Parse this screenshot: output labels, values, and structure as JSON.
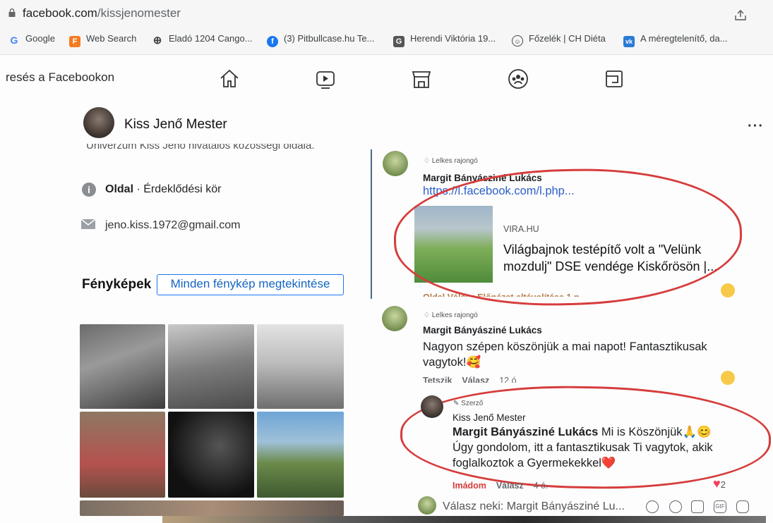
{
  "browser": {
    "url_domain": "facebook.com",
    "url_path": "/kissjenomester"
  },
  "bookmarks": [
    {
      "label": "Google",
      "icon": "G",
      "color": "#4285f4"
    },
    {
      "label": "Web Search",
      "icon": "F",
      "color": "#f47b20"
    },
    {
      "label": "Eladó 1204 Cango...",
      "icon": "globe-icon",
      "color": "#444444"
    },
    {
      "label": "(3) Pitbullcase.hu Te...",
      "icon": "f",
      "color": "#1877f2"
    },
    {
      "label": "Herendi Viktória 19...",
      "icon": "G",
      "color": "#555555"
    },
    {
      "label": "Főzelék | CH Diéta",
      "icon": "chef-icon",
      "color": "#444444"
    },
    {
      "label": "A méregtelenítő, da...",
      "icon": "vk",
      "color": "#2a7bd6"
    }
  ],
  "nav": {
    "search_text": "resés a Facebookon"
  },
  "page": {
    "name": "Kiss Jenő Mester",
    "about_cut": "Univerzum Kiss Jenő hivatalos közösségi oldala.",
    "category_bold": "Oldal",
    "category_rest": " · Érdeklődési kör",
    "email": "jeno.kiss.1972@gmail.com",
    "photos_title": "Fényképek",
    "photos_button": "Minden fénykép megtekintése"
  },
  "comments": [
    {
      "badge": "Lelkes rajongó",
      "author": "Margit Bányásziné Lukács",
      "link": "https://l.facebook.com/l.php...",
      "preview_site": "VIRA.HU",
      "preview_title": "Világbajnok testépítő volt a \"Velünk mozdulj\" DSE vendége Kiskőrösön |...",
      "actions_cut": "Oldal   Válasz   Előnézet eltávolítása   1 n"
    },
    {
      "badge": "Lelkes rajongó",
      "author": "Margit Bányásziné Lukács",
      "text": "Nagyon szépen köszönjük a mai napot! Fantasztikusak vagytok!🥰",
      "like": "Tetszik",
      "reply": "Válasz",
      "time": "12 ó"
    },
    {
      "badge": "Szerző",
      "author": "Kiss Jenő Mester",
      "mention": "Margit Bányásziné Lukács",
      "text": " Mi is Köszönjük🙏😊 Úgy gondolom, itt a fantasztikusak Ti vagytok, akik foglalkoztok a Gyermekekkel❤️",
      "like": "Imádom",
      "reply": "Válasz",
      "time": "4 ó.",
      "reaction_count": "2"
    }
  ],
  "reply_box": {
    "placeholder": "Válasz neki: Margit Bányásziné Lu..."
  },
  "colors": {
    "accent": "#1877f2",
    "annotation": "#d63c3c"
  }
}
